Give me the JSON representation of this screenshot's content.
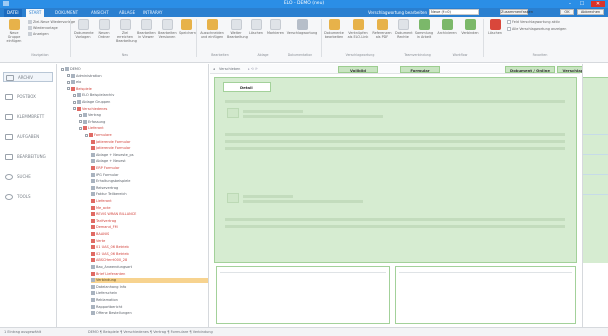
{
  "window": {
    "title": "ELO - DEMO (neu)",
    "buttons": {
      "minimize": "–",
      "maximize": "☐",
      "close": "✕"
    }
  },
  "tabs": [
    {
      "label": "DATEI",
      "kind": "file"
    },
    {
      "label": "START",
      "kind": "active"
    },
    {
      "label": "DOKUMENT",
      "kind": "normal"
    },
    {
      "label": "ANSICHT",
      "kind": "normal"
    },
    {
      "label": "ABLAGE",
      "kind": "normal"
    },
    {
      "label": "INTRARAY",
      "kind": "normal"
    }
  ],
  "topbar": {
    "user_label": "Verschlagwortung bearbeiten",
    "user_value": "Neue (f=0)",
    "btn_zusammenfassen": "Zusammenfassen",
    "btn_ok": "OK",
    "btn_abbrechen": "Abbrechen"
  },
  "ribbon": {
    "left_rows": [
      "Ziel-Neue Wiedervorlage",
      "Wiedervorlage",
      "Anzeigen"
    ],
    "buttons": [
      "Neue Gruppe einfügen",
      "Dokumente Vorlagen",
      "Neuen Ordner",
      "Ziel erreichen Bearbeitung",
      "Bearbeiten in Viewer",
      "Bearbeiten Versionen",
      "Speichern",
      "Ausschneiden und einfügen",
      "Weiter Bearbeitung",
      "Löschen",
      "Markieren",
      "Verschlagwortung",
      "Dokumente bearbeiten",
      "Verknüpfen als ELO-Link",
      "Referenzen als PDF",
      "Dokument Rechte",
      "Sammlung in Arbeit",
      "Archivieren",
      "Verbinden"
    ],
    "right_checks": [
      "Feld Verschlagwortung aktiv",
      "Alle Verschlagwortung anzeigen"
    ],
    "groups": [
      "Navigation",
      "Neu",
      "Bearbeiten",
      "Ablage",
      "Dokumentation",
      "Verschlagwortung",
      "Teamverbindung",
      "Workflow",
      "Favoriten",
      "Löschen"
    ]
  },
  "leftnav": [
    {
      "label": "ARCHIV",
      "active": true
    },
    {
      "label": "POSTBOX",
      "active": false
    },
    {
      "label": "KLEMMBRETT",
      "active": false
    },
    {
      "label": "AUFGABEN",
      "active": false
    },
    {
      "label": "BEARBEITUNG",
      "active": false
    },
    {
      "label": "SUCHE",
      "active": false
    },
    {
      "label": "TOOLS",
      "active": false
    }
  ],
  "tree": [
    {
      "label": "DEMO",
      "level": 0,
      "color": "gray"
    },
    {
      "label": "Administration",
      "level": 1,
      "color": "gray"
    },
    {
      "label": "elo",
      "level": 1,
      "color": "gray"
    },
    {
      "label": "Beispiele",
      "level": 1,
      "color": "red"
    },
    {
      "label": "ELO Beispielarchiv",
      "level": 2,
      "color": "gray"
    },
    {
      "label": "Ablage Gruppen",
      "level": 2,
      "color": "gray"
    },
    {
      "label": "Verschiedenes",
      "level": 2,
      "color": "red"
    },
    {
      "label": "Vertrag",
      "level": 3,
      "color": "gray"
    },
    {
      "label": "Erfassung",
      "level": 3,
      "color": "gray"
    },
    {
      "label": "Lieferant",
      "level": 3,
      "color": "red"
    },
    {
      "label": "Formulare",
      "level": 4,
      "color": "red"
    },
    {
      "label": "Jatierende Formular",
      "level": 5,
      "color": "red"
    },
    {
      "label": "Jatierende Formular",
      "level": 5,
      "color": "red"
    },
    {
      "label": "Ablage + Neueste_ps",
      "level": 5,
      "color": "gray"
    },
    {
      "label": "Ablage + Neuest",
      "level": 5,
      "color": "gray"
    },
    {
      "label": "ERP Formular",
      "level": 5,
      "color": "red"
    },
    {
      "label": "IPG Formular",
      "level": 5,
      "color": "gray"
    },
    {
      "label": "Erhaltungsbeispiele",
      "level": 5,
      "color": "gray"
    },
    {
      "label": "Reisevertrag",
      "level": 5,
      "color": "gray"
    },
    {
      "label": "Faktur Teilbereich",
      "level": 5,
      "color": "gray"
    },
    {
      "label": "Lieferant",
      "level": 5,
      "color": "red"
    },
    {
      "label": "Me_acte",
      "level": 5,
      "color": "red"
    },
    {
      "label": "REVIS WRAN BILLANCE",
      "level": 5,
      "color": "red"
    },
    {
      "label": "Tarifvertrag",
      "level": 5,
      "color": "red"
    },
    {
      "label": "Demand_FM",
      "level": 5,
      "color": "red"
    },
    {
      "label": "BAANIS",
      "level": 5,
      "color": "red"
    },
    {
      "label": "Verte",
      "level": 5,
      "color": "red"
    },
    {
      "label": "01 UAS_06 Betrieb",
      "level": 5,
      "color": "red"
    },
    {
      "label": "02 UAS_06 Betrieb",
      "level": 5,
      "color": "red"
    },
    {
      "label": "ABSCHerrt000_28",
      "level": 5,
      "color": "red"
    },
    {
      "label": "Bao_Anwendungsart",
      "level": 5,
      "color": "gray"
    },
    {
      "label": "Brief Lieferanten",
      "level": 5,
      "color": "red"
    },
    {
      "label": "Verbindung",
      "level": 5,
      "color": "gray",
      "selected": true
    },
    {
      "label": "Dateianhang Info",
      "level": 5,
      "color": "gray"
    },
    {
      "label": "Lieferschein",
      "level": 5,
      "color": "gray"
    },
    {
      "label": "Reklamation",
      "level": 5,
      "color": "gray"
    },
    {
      "label": "Rapportbericht",
      "level": 5,
      "color": "gray"
    },
    {
      "label": "Offene Bestellungen",
      "level": 5,
      "color": "gray"
    }
  ],
  "main": {
    "toolbar_label": "Verschieben",
    "btn_vollbild": "Vollbild",
    "btn_formular": "Formular",
    "btn_dokument_online": "Dokument / Online",
    "btn_verschlagwortung": "Verschlagwortung",
    "tab_label": "Detail"
  },
  "status": {
    "left": "1 Eintrag ausgewählt",
    "path": "DEMO ¶ Beispiele ¶ Verschiedenes ¶ Vertrag ¶ Formulare ¶ Verbindung"
  }
}
